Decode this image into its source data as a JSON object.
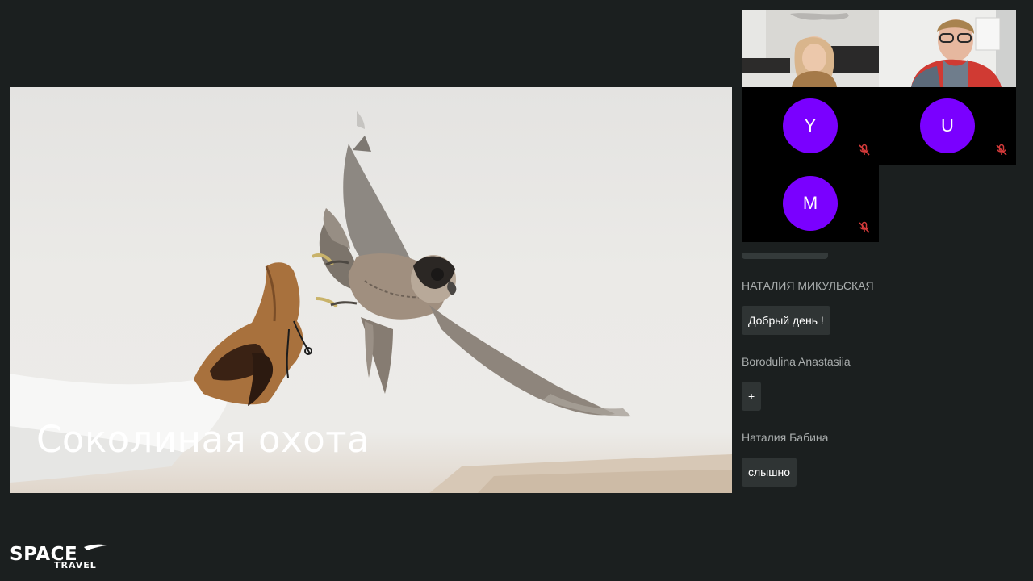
{
  "slide": {
    "caption": "Соколиная охота"
  },
  "participants": [
    {
      "type": "video",
      "name": "participant-video-1"
    },
    {
      "type": "video",
      "name": "participant-video-2"
    },
    {
      "type": "avatar",
      "initial": "Y",
      "muted": true
    },
    {
      "type": "avatar",
      "initial": "U",
      "muted": true
    },
    {
      "type": "avatar",
      "initial": "M",
      "muted": true
    }
  ],
  "chat": {
    "messages": [
      {
        "author": "НАТАЛИЯ МИКУЛЬСКАЯ",
        "text": "Добрый день !"
      },
      {
        "author": "Borodulina Anastasiia",
        "text": "+"
      },
      {
        "author": "Наталия Бабина",
        "text": "слышно"
      }
    ]
  },
  "logo": {
    "line1": "SPACE",
    "line2": "TRAVEL"
  },
  "colors": {
    "background": "#1b1f1f",
    "avatar": "#7a00ff",
    "mute": "#d63b3b",
    "bubble": "#2f3434"
  },
  "icons": {
    "mute": "mic-off-icon"
  }
}
